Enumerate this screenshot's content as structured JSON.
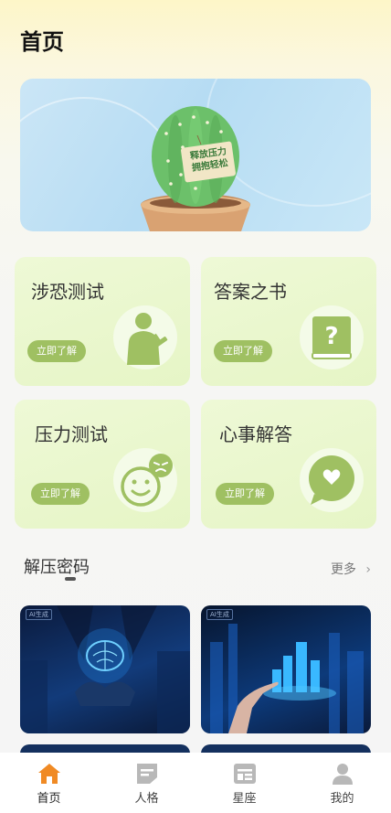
{
  "header": {
    "title": "首页"
  },
  "banner": {
    "sign_line1": "释放压力",
    "sign_line2": "拥抱轻松"
  },
  "cards": [
    {
      "title": "涉恐测试",
      "button": "立即了解",
      "icon": "soldier-icon"
    },
    {
      "title": "答案之书",
      "button": "立即了解",
      "icon": "question-book-icon"
    },
    {
      "title": "压力测试",
      "button": "立即了解",
      "icon": "smiley-icon"
    },
    {
      "title": "心事解答",
      "button": "立即了解",
      "icon": "heart-chat-icon"
    }
  ],
  "section": {
    "title": "解压密码",
    "more": "更多"
  },
  "thumbs": [
    {
      "tag": "AI生成"
    },
    {
      "tag": "AI生成"
    }
  ],
  "tabbar": {
    "items": [
      {
        "label": "首页",
        "icon": "home-icon"
      },
      {
        "label": "人格",
        "icon": "document-icon"
      },
      {
        "label": "星座",
        "icon": "calendar-icon"
      },
      {
        "label": "我的",
        "icon": "person-icon"
      }
    ]
  },
  "colors": {
    "accent_green": "#9fc062",
    "active_tab": "#f08a24",
    "inactive_tab": "#b8b8b8"
  }
}
